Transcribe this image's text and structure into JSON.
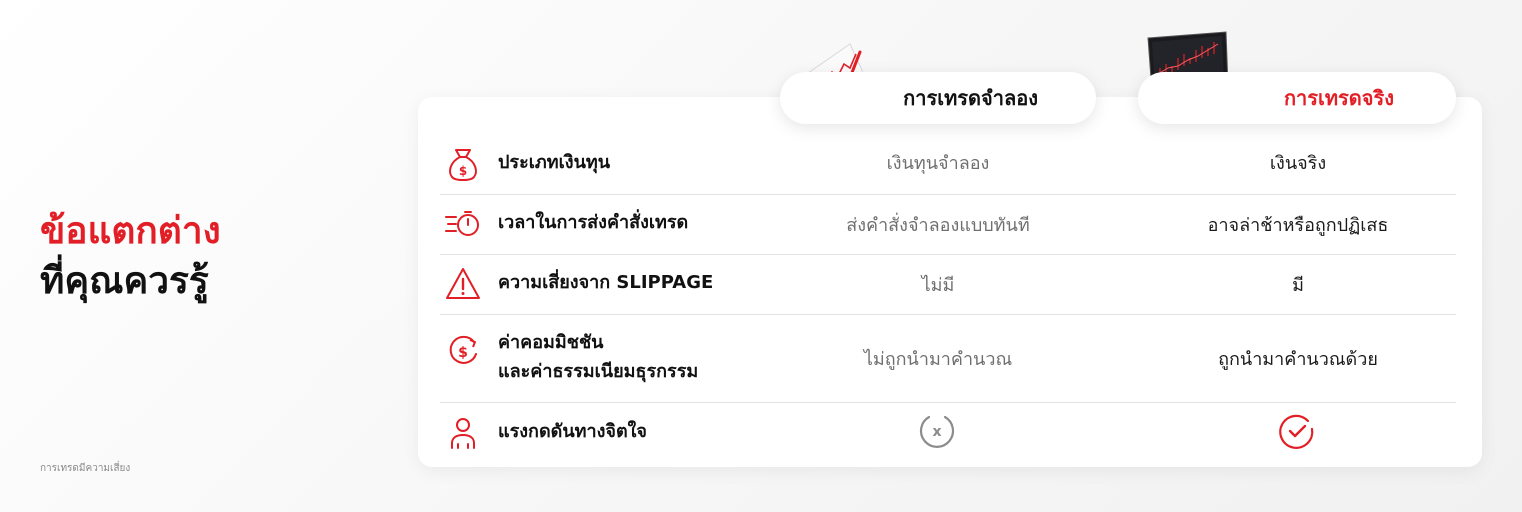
{
  "headline": {
    "line1": "ข้อแตกต่าง",
    "line2": "ที่คุณควรรู้"
  },
  "disclaimer": "การเทรดมีความเสี่ยง",
  "columns": {
    "demo": "การเทรดจำลอง",
    "real": "การเทรดจริง"
  },
  "rows": [
    {
      "icon": "money-bag-icon",
      "label": "ประเภทเงินทุน",
      "demo": "เงินทุนจำลอง",
      "real": "เงินจริง"
    },
    {
      "icon": "stopwatch-icon",
      "label": "เวลาในการส่งคำสั่งเทรด",
      "demo": "ส่งคำสั่งจำลองแบบทันที",
      "real": "อาจล่าช้าหรือถูกปฏิเสธ"
    },
    {
      "icon": "warning-triangle-icon",
      "label": "ความเสี่ยงจาก SLIPPAGE",
      "demo": "ไม่มี",
      "real": "มี"
    },
    {
      "icon": "dollar-refresh-icon",
      "label_line1": "ค่าคอมมิชชัน",
      "label_line2": "และค่าธรรมเนียมธุรกรรม",
      "demo": "ไม่ถูกนำมาคำนวณ",
      "real": "ถูกนำมาคำนวณด้วย"
    },
    {
      "icon": "user-icon",
      "label": "แรงกดดันทางจิตใจ",
      "demo_symbol": "x",
      "real_symbol": "check-icon"
    }
  ],
  "colors": {
    "accent": "#e21f26",
    "text": "#111111",
    "muted": "#6f6f6f",
    "divider": "#e3e3e3"
  }
}
